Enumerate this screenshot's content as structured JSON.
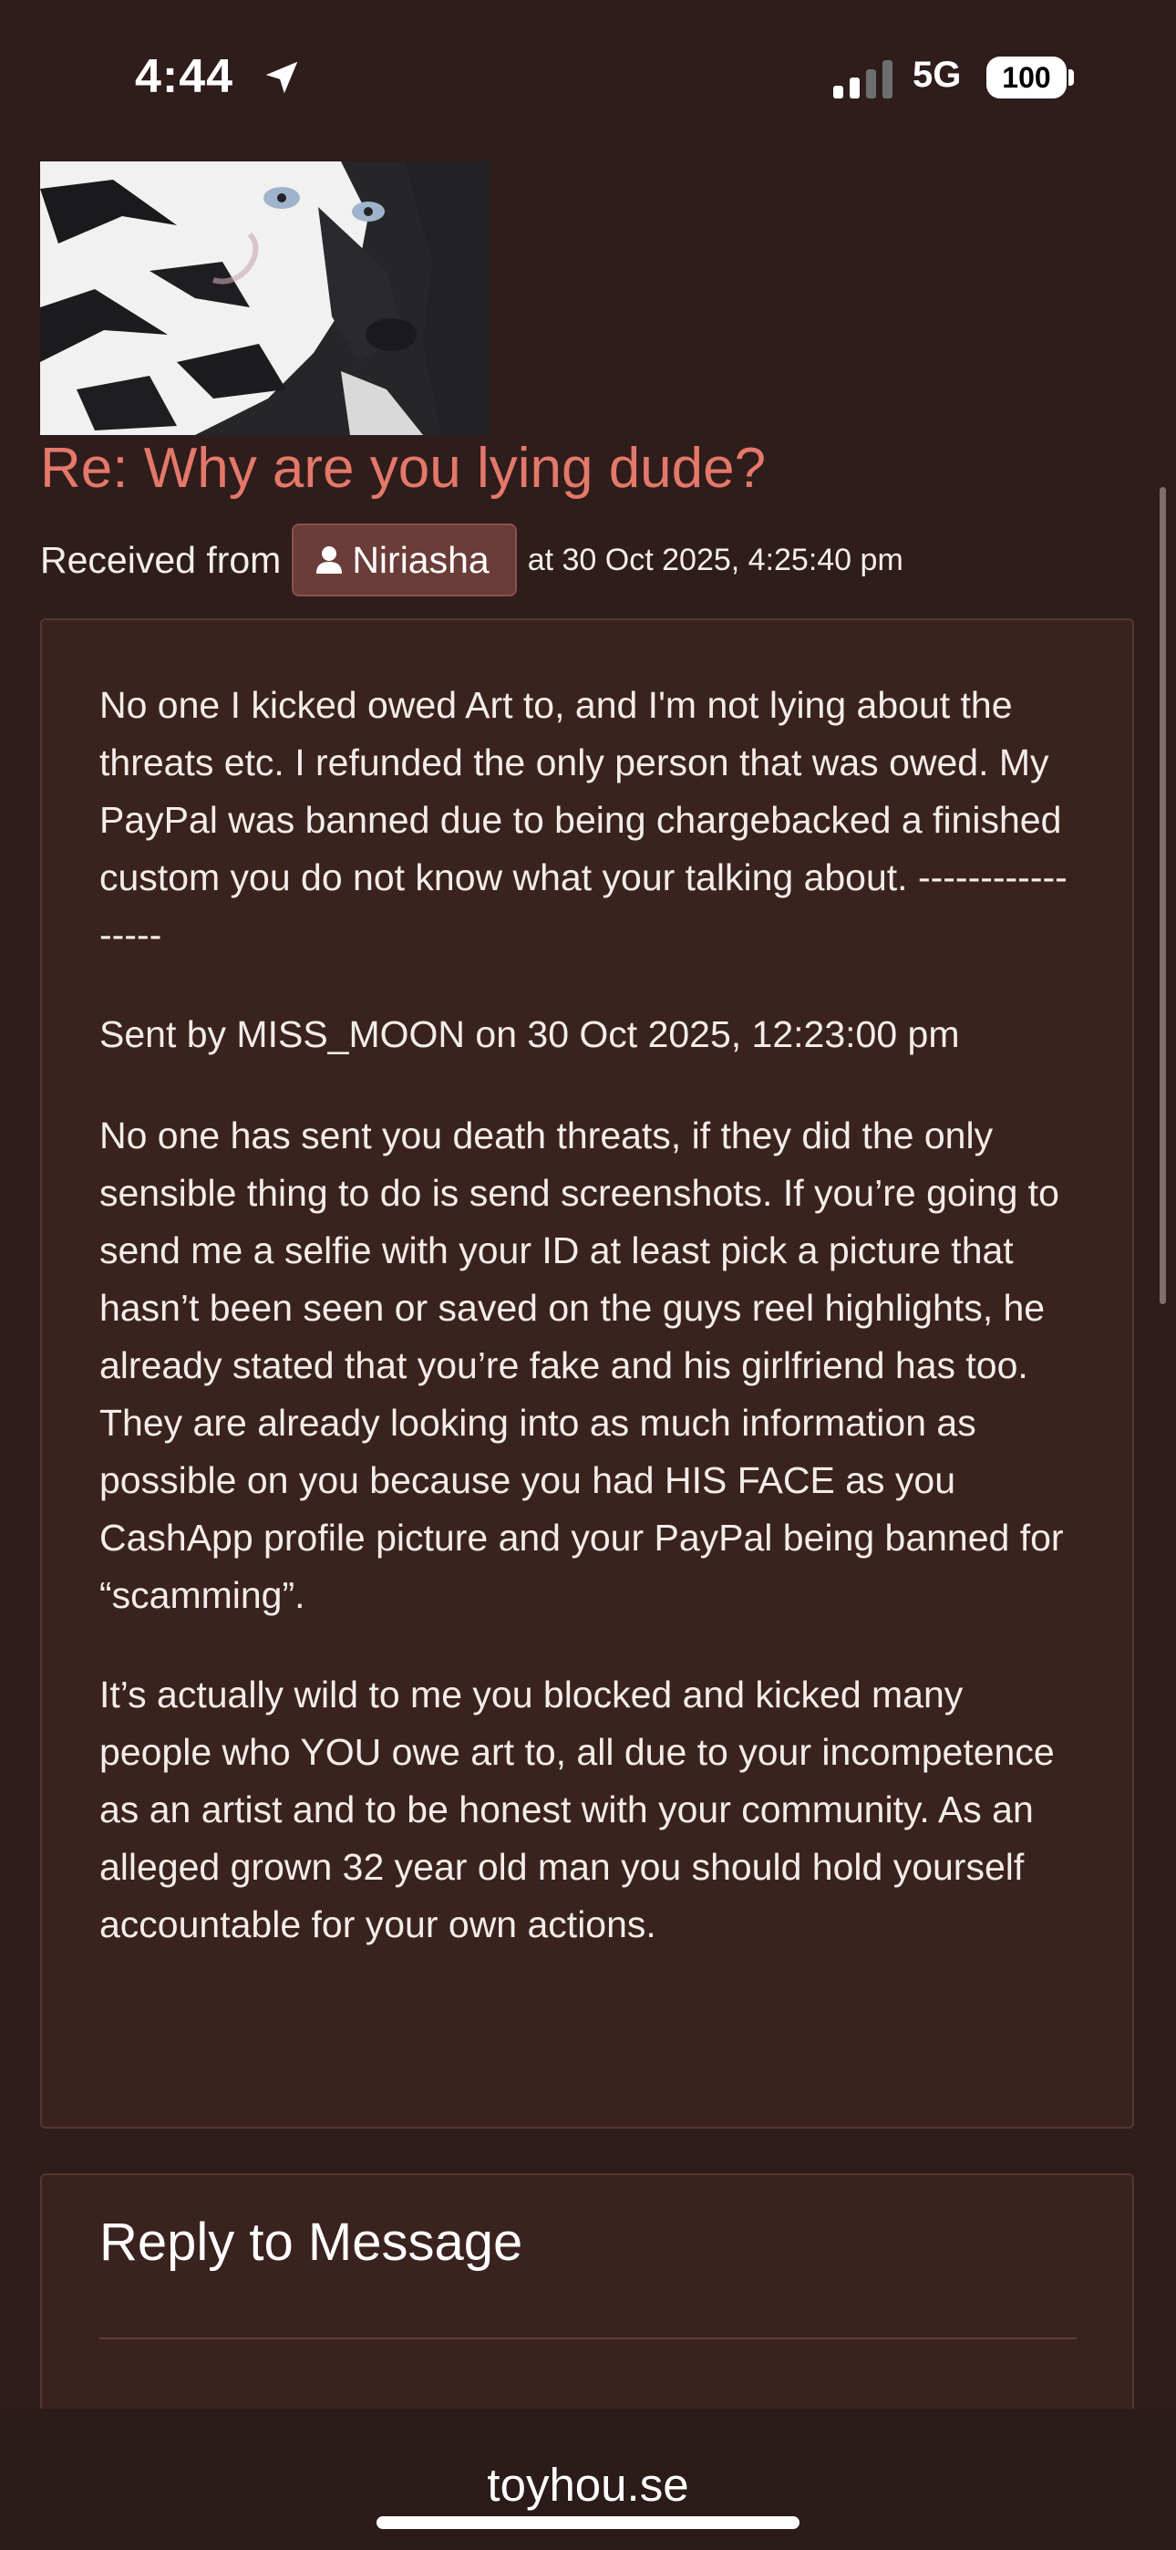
{
  "status_bar": {
    "time": "4:44",
    "network": "5G",
    "battery": "100",
    "icons": [
      "location-arrow-icon",
      "cellular-signal-icon",
      "battery-icon"
    ]
  },
  "message": {
    "title": "Re: Why are you lying dude?",
    "received_label": "Received from",
    "sender": "Niriasha",
    "received_time": "at 30 Oct 2025, 4:25:40 pm",
    "paragraphs": [
      "No one I kicked owed Art to, and I'm not lying about the threats etc. I refunded the only person that was owed. My PayPal was banned due to being chargebacked a finished custom you do not know what your talking about. -----------------",
      "Sent by MISS_MOON on 30 Oct 2025, 12:23:00 pm",
      "No one has sent you death threats, if they did the only sensible thing to do is send screenshots. If you’re going to send me a selfie with your ID at least pick a picture that hasn’t been seen or saved on the guys reel highlights, he already stated that you’re fake and his girlfriend has too. They are already looking into as much information as possible on you because you had HIS FACE as you CashApp profile picture and your PayPal being banned for “scamming”.",
      "It’s actually wild to me you blocked and kicked many people who YOU owe art to, all due to your incompetence as an artist and to be honest with your community. As an alleged grown 32 year old man you should hold yourself accountable for your own actions."
    ]
  },
  "reply": {
    "title": "Reply to Message"
  },
  "browser": {
    "domain": "toyhou.se"
  },
  "colors": {
    "background": "#2e1d1b",
    "panel": "#3a221f",
    "panel_border": "#543731",
    "title_accent": "#e4786a",
    "user_badge": "#6b3d38"
  }
}
